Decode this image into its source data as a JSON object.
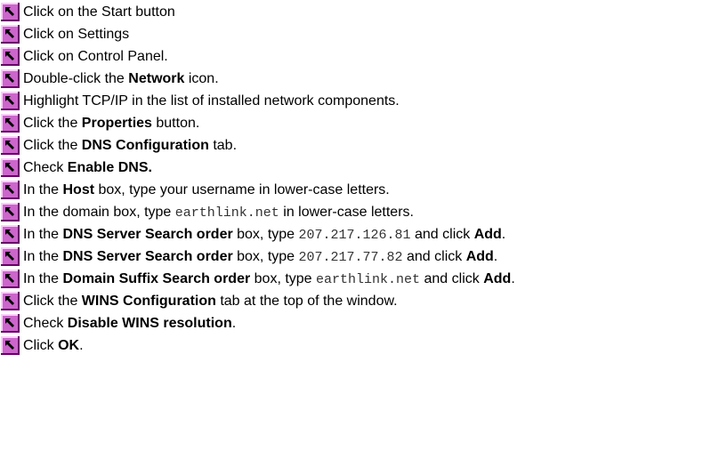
{
  "document": {
    "steps": [
      {
        "icon": "arrow-icon",
        "segments": [
          {
            "text": "Click on the Start button",
            "style": "normal"
          }
        ]
      },
      {
        "icon": "arrow-icon",
        "segments": [
          {
            "text": "Click on Settings",
            "style": "normal"
          }
        ]
      },
      {
        "icon": "arrow-icon",
        "segments": [
          {
            "text": "Click on Control Panel.",
            "style": "normal"
          }
        ]
      },
      {
        "icon": "arrow-icon",
        "segments": [
          {
            "text": "Double-click the ",
            "style": "normal"
          },
          {
            "text": "Network",
            "style": "bold"
          },
          {
            "text": " icon.",
            "style": "normal"
          }
        ]
      },
      {
        "icon": "arrow-icon",
        "segments": [
          {
            "text": "Highlight TCP/IP in the list of installed network components.",
            "style": "normal"
          }
        ]
      },
      {
        "icon": "arrow-icon",
        "segments": [
          {
            "text": "Click the ",
            "style": "normal"
          },
          {
            "text": "Properties",
            "style": "bold"
          },
          {
            "text": " button.",
            "style": "normal"
          }
        ]
      },
      {
        "icon": "arrow-icon",
        "segments": [
          {
            "text": "Click the ",
            "style": "normal"
          },
          {
            "text": "DNS Configuration",
            "style": "bold"
          },
          {
            "text": " tab.",
            "style": "normal"
          }
        ]
      },
      {
        "icon": "arrow-icon",
        "segments": [
          {
            "text": "Check ",
            "style": "normal"
          },
          {
            "text": "Enable DNS.",
            "style": "bold"
          }
        ]
      },
      {
        "icon": "arrow-icon",
        "segments": [
          {
            "text": "In the ",
            "style": "normal"
          },
          {
            "text": "Host",
            "style": "bold"
          },
          {
            "text": " box, type your username in lower-case letters.",
            "style": "normal"
          }
        ]
      },
      {
        "icon": "arrow-icon",
        "segments": [
          {
            "text": "In the domain box, type ",
            "style": "normal"
          },
          {
            "text": "earthlink.net",
            "style": "mono"
          },
          {
            "text": " in lower-case letters.",
            "style": "normal"
          }
        ]
      },
      {
        "icon": "arrow-icon",
        "segments": [
          {
            "text": "In the ",
            "style": "normal"
          },
          {
            "text": "DNS Server Search order",
            "style": "bold"
          },
          {
            "text": " box, type ",
            "style": "normal"
          },
          {
            "text": "207.217.126.81",
            "style": "mono"
          },
          {
            "text": "  and click ",
            "style": "normal"
          },
          {
            "text": "Add",
            "style": "bold"
          },
          {
            "text": ".",
            "style": "normal"
          }
        ]
      },
      {
        "icon": "arrow-icon",
        "segments": [
          {
            "text": "In the ",
            "style": "normal"
          },
          {
            "text": "DNS Server Search order",
            "style": "bold"
          },
          {
            "text": " box, type ",
            "style": "normal"
          },
          {
            "text": "207.217.77.82",
            "style": "mono"
          },
          {
            "text": "  and click ",
            "style": "normal"
          },
          {
            "text": "Add",
            "style": "bold"
          },
          {
            "text": ".",
            "style": "normal"
          }
        ]
      },
      {
        "icon": "arrow-icon",
        "segments": [
          {
            "text": "In the ",
            "style": "normal"
          },
          {
            "text": "Domain Suffix Search order",
            "style": "bold"
          },
          {
            "text": " box, type ",
            "style": "normal"
          },
          {
            "text": "earthlink.net",
            "style": "mono"
          },
          {
            "text": " and click ",
            "style": "normal"
          },
          {
            "text": "Add",
            "style": "bold"
          },
          {
            "text": ".",
            "style": "normal"
          }
        ]
      },
      {
        "icon": "arrow-icon",
        "segments": [
          {
            "text": "Click the ",
            "style": "normal"
          },
          {
            "text": "WINS Configuration",
            "style": "bold"
          },
          {
            "text": " tab at the top of the window.",
            "style": "normal"
          }
        ]
      },
      {
        "icon": "arrow-icon",
        "segments": [
          {
            "text": "Check ",
            "style": "normal"
          },
          {
            "text": "Disable WINS resolution",
            "style": "bold"
          },
          {
            "text": ".",
            "style": "normal"
          }
        ]
      },
      {
        "icon": "arrow-icon",
        "segments": [
          {
            "text": "Click ",
            "style": "normal"
          },
          {
            "text": "OK",
            "style": "bold"
          },
          {
            "text": ".",
            "style": "normal"
          }
        ]
      }
    ]
  },
  "colors": {
    "icon_fill": "#cc66cc",
    "icon_highlight": "#ffccff",
    "icon_shadow": "#660066",
    "icon_arrow": "#000000",
    "text": "#000000",
    "mono_text": "#333333"
  }
}
